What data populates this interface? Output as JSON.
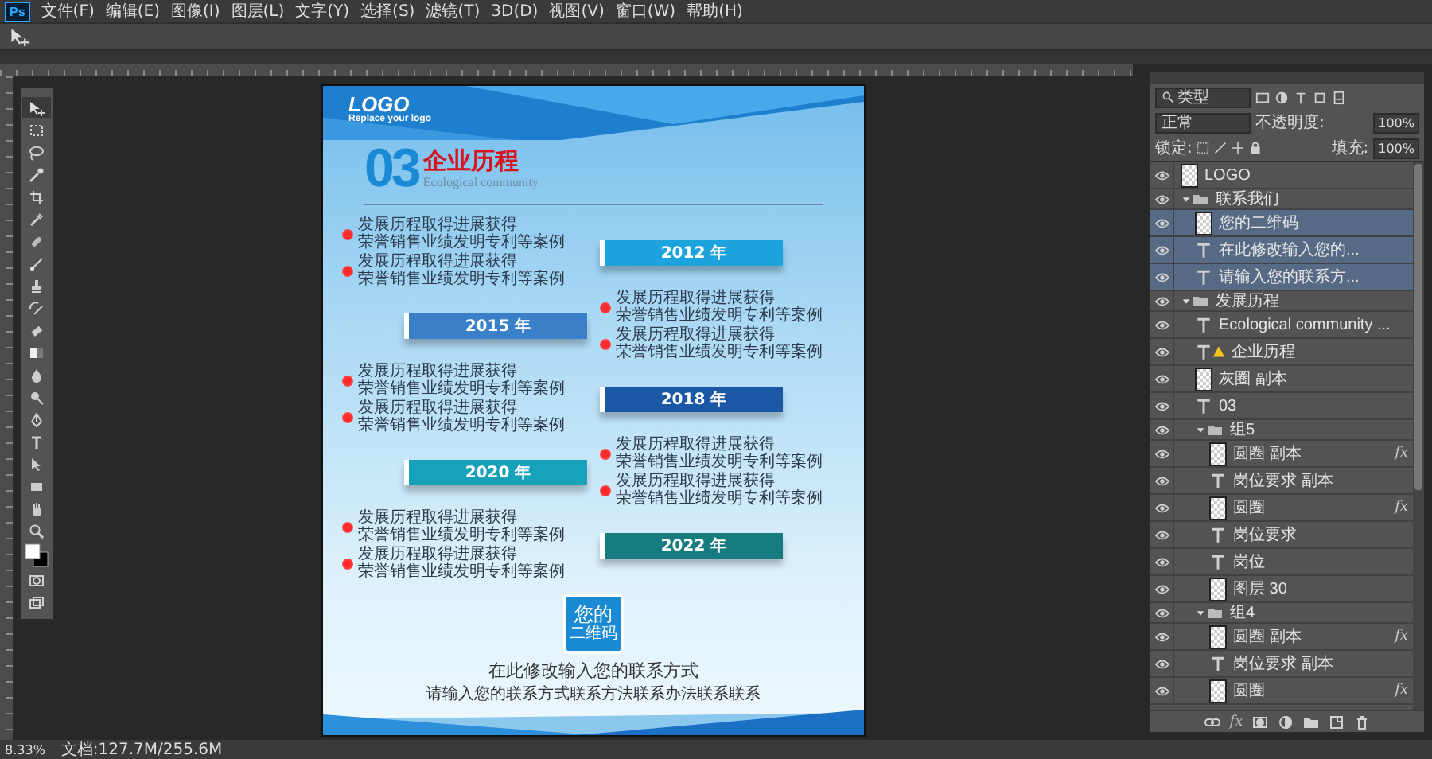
{
  "menu_bar": {
    "app_logo": "Ps",
    "items": [
      "文件(F)",
      "编辑(E)",
      "图像(I)",
      "图层(L)",
      "文字(Y)",
      "选择(S)",
      "滤镜(T)",
      "3D(D)",
      "视图(V)",
      "窗口(W)",
      "帮助(H)"
    ]
  },
  "toolbox": {
    "tools": [
      {
        "kind": "move",
        "selected": true
      },
      {
        "kind": "marquee",
        "selected": false
      },
      {
        "kind": "lasso",
        "selected": false
      },
      {
        "kind": "wand",
        "selected": false
      },
      {
        "kind": "crop",
        "selected": false
      },
      {
        "kind": "eyedropper",
        "selected": false
      },
      {
        "kind": "healing",
        "selected": false
      },
      {
        "kind": "brush",
        "selected": false
      },
      {
        "kind": "stamp",
        "selected": false
      },
      {
        "kind": "history",
        "selected": false
      },
      {
        "kind": "eraser",
        "selected": false
      },
      {
        "kind": "gradient",
        "selected": false
      },
      {
        "kind": "blur",
        "selected": false
      },
      {
        "kind": "dodge",
        "selected": false
      },
      {
        "kind": "pen",
        "selected": false
      },
      {
        "kind": "type",
        "selected": false
      },
      {
        "kind": "path",
        "selected": false
      },
      {
        "kind": "shape",
        "selected": false
      },
      {
        "kind": "hand",
        "selected": false
      },
      {
        "kind": "zoom",
        "selected": false
      },
      {
        "kind": "swatches",
        "selected": false
      },
      {
        "kind": "quickmask",
        "selected": false
      },
      {
        "kind": "screen",
        "selected": false
      }
    ]
  },
  "poster": {
    "logo": "LOGO",
    "logo_tagline": "Replace your logo",
    "number": "03",
    "title": "企业历程",
    "subtitle": "Ecological community",
    "timeline": [
      {
        "year": "2012 年",
        "color": "#1ca3de",
        "items": [
          [
            "发展历程取得进展获得",
            "荣誉销售业绩发明专利等案例"
          ],
          [
            "发展历程取得进展获得",
            "荣誉销售业绩发明专利等案例"
          ]
        ]
      },
      {
        "year": "2015 年",
        "color": "#3a80c9",
        "items": [
          [
            "发展历程取得进展获得",
            "荣誉销售业绩发明专利等案例"
          ],
          [
            "发展历程取得进展获得",
            "荣誉销售业绩发明专利等案例"
          ]
        ]
      },
      {
        "year": "2018 年",
        "color": "#1b58a6",
        "items": [
          [
            "发展历程取得进展获得",
            "荣誉销售业绩发明专利等案例"
          ],
          [
            "发展历程取得进展获得",
            "荣誉销售业绩发明专利等案例"
          ]
        ]
      },
      {
        "year": "2020 年",
        "color": "#17a2ba",
        "items": [
          [
            "发展历程取得进展获得",
            "荣誉销售业绩发明专利等案例"
          ],
          [
            "发展历程取得进展获得",
            "荣誉销售业绩发明专利等案例"
          ]
        ]
      },
      {
        "year": "2022 年",
        "color": "#157b7f",
        "items": [
          [
            "发展历程取得进展获得",
            "荣誉销售业绩发明专利等案例"
          ],
          [
            "发展历程取得进展获得",
            "荣誉销售业绩发明专利等案例"
          ]
        ]
      }
    ],
    "qr_label": "您的",
    "qr_sublabel": "二维码",
    "contact_title": "在此修改输入您的联系方式",
    "contact_text": "请输入您的联系方式联系方法联系办法联系联系"
  },
  "layers_panel": {
    "filter": "类型",
    "blend_mode": "正常",
    "opacity_label": "不透明度:",
    "opacity": "100%",
    "lock_label": "锁定:",
    "fill_label": "填充:",
    "fill": "100%",
    "style_button": "fx",
    "layers": [
      {
        "name": "LOGO",
        "kind": "image",
        "selected": false,
        "warning": false
      },
      {
        "name": "联系我们",
        "kind": "group",
        "selected": false,
        "warning": false,
        "expanded": true,
        "children": [
          {
            "name": "您的二维码",
            "kind": "smart",
            "selected": true,
            "warning": false
          },
          {
            "name": "在此修改输入您的...",
            "kind": "text",
            "selected": true,
            "warning": false
          },
          {
            "name": "请输入您的联系方...",
            "kind": "text",
            "selected": true,
            "warning": false
          }
        ]
      },
      {
        "name": "发展历程",
        "kind": "group",
        "selected": false,
        "warning": false,
        "expanded": true,
        "children": [
          {
            "name": "Ecological community ...",
            "kind": "text",
            "selected": false,
            "warning": false
          },
          {
            "name": "企业历程",
            "kind": "text",
            "selected": false,
            "warning": true
          },
          {
            "name": "灰圈 副本",
            "kind": "image",
            "selected": false,
            "warning": false
          },
          {
            "name": "03",
            "kind": "text",
            "selected": false,
            "warning": false
          },
          {
            "name": "组5",
            "kind": "group",
            "selected": false,
            "warning": false,
            "expanded": true,
            "children": [
              {
                "name": "圆圈 副本",
                "kind": "smart",
                "selected": false,
                "warning": false,
                "effects": "fx"
              },
              {
                "name": "岗位要求 副本",
                "kind": "text",
                "selected": false,
                "warning": false
              },
              {
                "name": "圆圈",
                "kind": "smart",
                "selected": false,
                "warning": false,
                "effects": "fx"
              },
              {
                "name": "岗位要求",
                "kind": "text",
                "selected": false,
                "warning": false
              },
              {
                "name": "岗位",
                "kind": "text",
                "selected": false,
                "warning": false
              },
              {
                "name": "图层 30",
                "kind": "image",
                "selected": false,
                "warning": false
              }
            ]
          },
          {
            "name": "组4",
            "kind": "group",
            "selected": false,
            "warning": false,
            "expanded": true,
            "children": [
              {
                "name": "圆圈 副本",
                "kind": "smart",
                "selected": false,
                "warning": false,
                "effects": "fx"
              },
              {
                "name": "岗位要求 副本",
                "kind": "text",
                "selected": false,
                "warning": false
              },
              {
                "name": "圆圈",
                "kind": "smart",
                "selected": false,
                "warning": false,
                "effects": "fx"
              }
            ]
          }
        ]
      }
    ]
  },
  "status_bar": {
    "zoom": "8.33%",
    "document": "文档:127.7M/255.6M"
  }
}
